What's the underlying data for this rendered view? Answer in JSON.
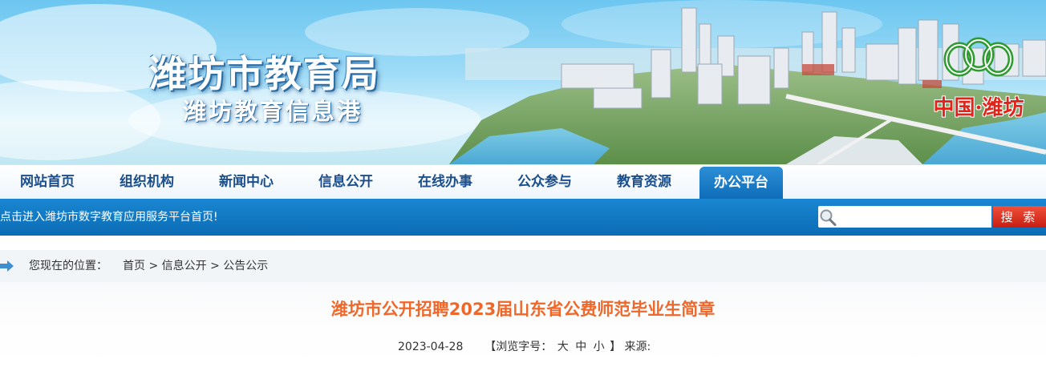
{
  "banner": {
    "title": "潍坊市教育局",
    "subtitle": "潍坊教育信息港",
    "city_mark": "中国·潍坊"
  },
  "nav": {
    "items": [
      {
        "label": "网站首页",
        "active": false
      },
      {
        "label": "组织机构",
        "active": false
      },
      {
        "label": "新闻中心",
        "active": false
      },
      {
        "label": "信息公开",
        "active": false
      },
      {
        "label": "在线办事",
        "active": false
      },
      {
        "label": "公众参与",
        "active": false
      },
      {
        "label": "教育资源",
        "active": false
      },
      {
        "label": "办公平台",
        "active": true
      }
    ]
  },
  "notice": {
    "text": "点击进入潍坊市数字教育应用服务平台首页!"
  },
  "search": {
    "placeholder": "",
    "button_label": "搜 索"
  },
  "breadcrumb": {
    "prefix": "您现在的位置：",
    "items": [
      "首页",
      "信息公开",
      "公告公示"
    ],
    "separator": ">"
  },
  "article": {
    "title": "潍坊市公开招聘2023届山东省公费师范毕业生简章",
    "date": "2023-04-28",
    "font_size_prefix": "【浏览字号：",
    "font_sizes": [
      "大",
      "中",
      "小"
    ],
    "font_size_suffix": "】",
    "source_label": "来源:"
  },
  "colors": {
    "nav_text": "#1b4f8c",
    "nav_active_bg": "#0e6bb8",
    "bluebar": "#0b6cb5",
    "search_button": "#d9281a",
    "article_title": "#f0672a"
  },
  "icons": {
    "search": "magnifier-icon",
    "breadcrumb": "arrow-right-icon",
    "city_mark": "three-ring-logo-icon"
  }
}
